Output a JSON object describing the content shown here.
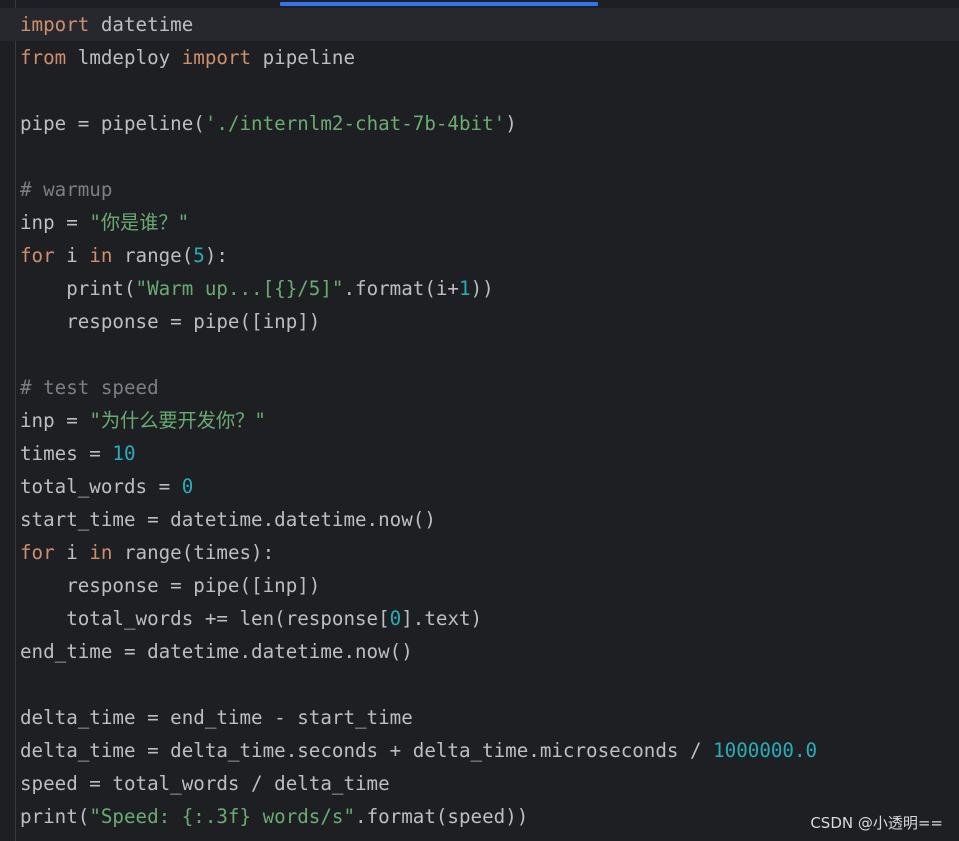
{
  "colors": {
    "background": "#1e1f22",
    "keyword": "#cf8e6d",
    "identifier": "#bcbec4",
    "string": "#6aab73",
    "number": "#2aacb8",
    "comment": "#7a7e85",
    "accent_bar": "#3574f0"
  },
  "code_lines": [
    [
      {
        "c": "kw",
        "t": "import"
      },
      {
        "c": "id",
        "t": " datetime"
      }
    ],
    [
      {
        "c": "kw",
        "t": "from"
      },
      {
        "c": "id",
        "t": " lmdeploy "
      },
      {
        "c": "kw",
        "t": "import"
      },
      {
        "c": "id",
        "t": " pipeline"
      }
    ],
    [],
    [
      {
        "c": "id",
        "t": "pipe = pipeline("
      },
      {
        "c": "str",
        "t": "'./internlm2-chat-7b-4bit'"
      },
      {
        "c": "id",
        "t": ")"
      }
    ],
    [],
    [
      {
        "c": "com",
        "t": "# warmup"
      }
    ],
    [
      {
        "c": "id",
        "t": "inp = "
      },
      {
        "c": "str",
        "t": "\"你是谁？\""
      }
    ],
    [
      {
        "c": "kw",
        "t": "for"
      },
      {
        "c": "id",
        "t": " i "
      },
      {
        "c": "kw",
        "t": "in"
      },
      {
        "c": "id",
        "t": " range("
      },
      {
        "c": "num",
        "t": "5"
      },
      {
        "c": "id",
        "t": "):"
      }
    ],
    [
      {
        "c": "id",
        "t": "    print("
      },
      {
        "c": "str",
        "t": "\"Warm up...[{}/5]\""
      },
      {
        "c": "id",
        "t": ".format(i+"
      },
      {
        "c": "num",
        "t": "1"
      },
      {
        "c": "id",
        "t": "))"
      }
    ],
    [
      {
        "c": "id",
        "t": "    response = pipe([inp])"
      }
    ],
    [],
    [
      {
        "c": "com",
        "t": "# test speed"
      }
    ],
    [
      {
        "c": "id",
        "t": "inp = "
      },
      {
        "c": "str",
        "t": "\"为什么要开发你？\""
      }
    ],
    [
      {
        "c": "id",
        "t": "times = "
      },
      {
        "c": "num",
        "t": "10"
      }
    ],
    [
      {
        "c": "id",
        "t": "total_words = "
      },
      {
        "c": "num",
        "t": "0"
      }
    ],
    [
      {
        "c": "id",
        "t": "start_time = datetime.datetime.now()"
      }
    ],
    [
      {
        "c": "kw",
        "t": "for"
      },
      {
        "c": "id",
        "t": " i "
      },
      {
        "c": "kw",
        "t": "in"
      },
      {
        "c": "id",
        "t": " range(times):"
      }
    ],
    [
      {
        "c": "id",
        "t": "    response = pipe([inp])"
      }
    ],
    [
      {
        "c": "id",
        "t": "    total_words += len(response["
      },
      {
        "c": "num",
        "t": "0"
      },
      {
        "c": "id",
        "t": "].text)"
      }
    ],
    [
      {
        "c": "id",
        "t": "end_time = datetime.datetime.now()"
      }
    ],
    [],
    [
      {
        "c": "id",
        "t": "delta_time = end_time - start_time"
      }
    ],
    [
      {
        "c": "id",
        "t": "delta_time = delta_time.seconds + delta_time.microseconds / "
      },
      {
        "c": "num",
        "t": "1000000.0"
      }
    ],
    [
      {
        "c": "id",
        "t": "speed = total_words / delta_time"
      }
    ],
    [
      {
        "c": "id",
        "t": "print("
      },
      {
        "c": "str",
        "t": "\"Speed: {:.3f} words/s\""
      },
      {
        "c": "id",
        "t": ".format(speed))"
      }
    ]
  ],
  "watermark": "CSDN @小透明=="
}
